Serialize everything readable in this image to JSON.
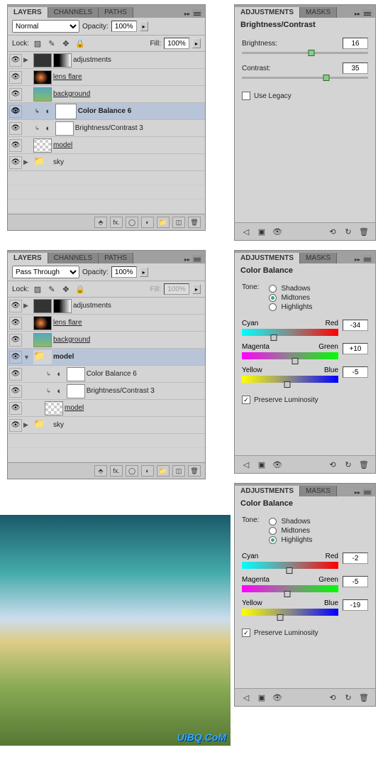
{
  "tabs": {
    "layers": "LAYERS",
    "channels": "CHANNELS",
    "paths": "PATHS",
    "adjustments": "ADJUSTMENTS",
    "masks": "MASKS"
  },
  "layerPanel1": {
    "blend": "Normal",
    "opacityLabel": "Opacity:",
    "opacity": "100%",
    "lockLabel": "Lock:",
    "fillLabel": "Fill:",
    "fill": "100%",
    "rows": [
      {
        "name": "adjustments"
      },
      {
        "name": "lens flare"
      },
      {
        "name": "background"
      },
      {
        "name": "Color Balance 6"
      },
      {
        "name": "Brightness/Contrast 3"
      },
      {
        "name": "model"
      },
      {
        "name": "sky"
      }
    ]
  },
  "layerPanel2": {
    "blend": "Pass Through",
    "opacityLabel": "Opacity:",
    "opacity": "100%",
    "lockLabel": "Lock:",
    "fillLabel": "Fill:",
    "fill": "100%",
    "rows": [
      {
        "name": "adjustments"
      },
      {
        "name": "lens flare"
      },
      {
        "name": "background"
      },
      {
        "name": "model"
      },
      {
        "name": "Color Balance 6"
      },
      {
        "name": "Brightness/Contrast 3"
      },
      {
        "name": "model"
      },
      {
        "name": "sky"
      }
    ]
  },
  "brightContrast": {
    "title": "Brightness/Contrast",
    "brightnessLabel": "Brightness:",
    "brightness": "16",
    "contrastLabel": "Contrast:",
    "contrast": "35",
    "legacyLabel": "Use Legacy",
    "legacy": false
  },
  "colorBalance1": {
    "title": "Color Balance",
    "toneLabel": "Tone:",
    "shadows": "Shadows",
    "midtones": "Midtones",
    "highlights": "Highlights",
    "selected": "midtones",
    "cyan": "Cyan",
    "red": "Red",
    "magenta": "Magenta",
    "green": "Green",
    "yellow": "Yellow",
    "blue": "Blue",
    "v1": "-34",
    "v2": "+10",
    "v3": "-5",
    "preserveLabel": "Preserve Luminosity",
    "preserve": true
  },
  "colorBalance2": {
    "title": "Color Balance",
    "toneLabel": "Tone:",
    "shadows": "Shadows",
    "midtones": "Midtones",
    "highlights": "Highlights",
    "selected": "highlights",
    "cyan": "Cyan",
    "red": "Red",
    "magenta": "Magenta",
    "green": "Green",
    "yellow": "Yellow",
    "blue": "Blue",
    "v1": "-2",
    "v2": "-5",
    "v3": "-19",
    "preserveLabel": "Preserve Luminosity",
    "preserve": true
  },
  "watermark": "UiBQ.CoM"
}
